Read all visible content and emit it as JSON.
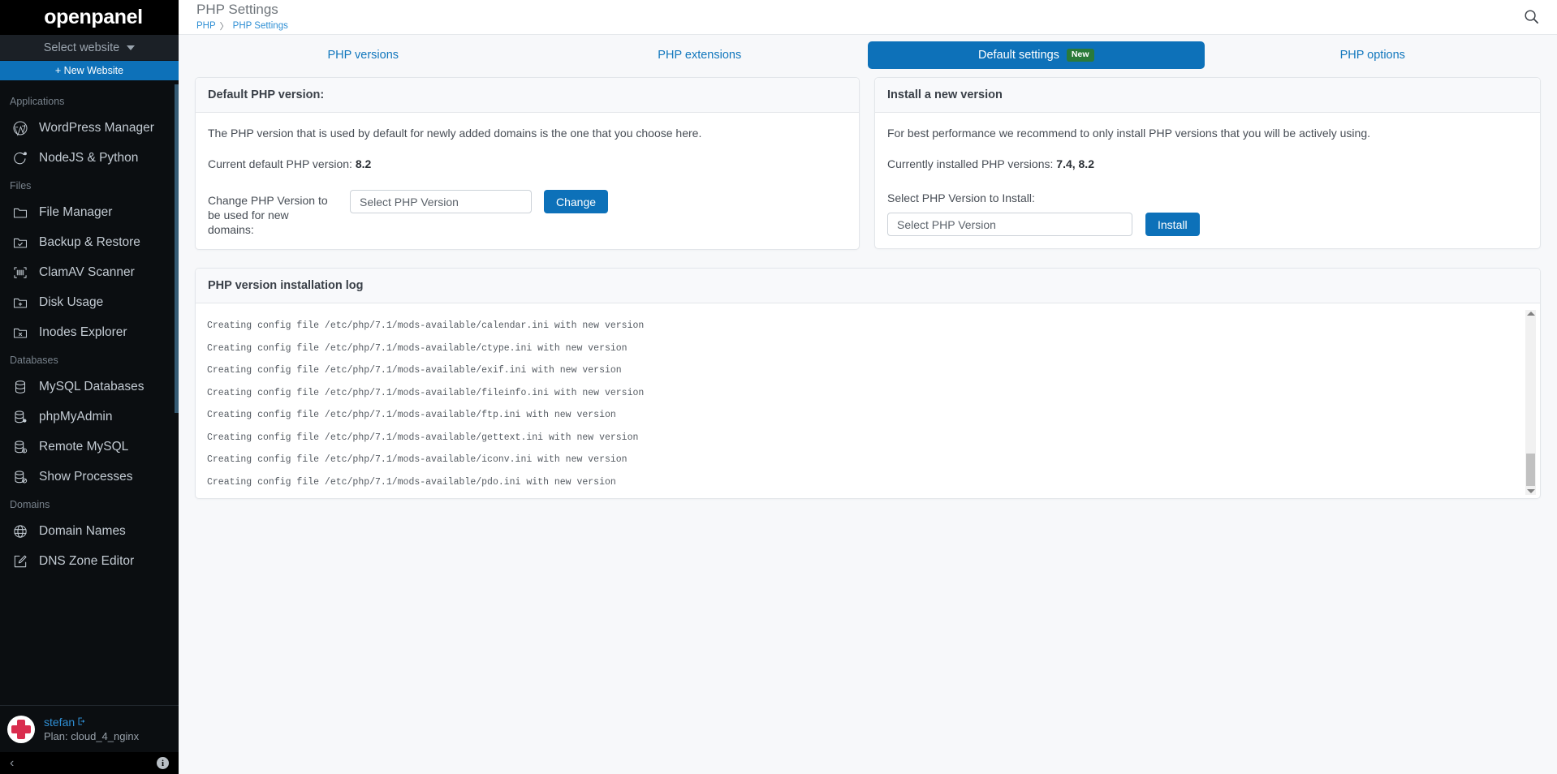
{
  "sidebar": {
    "brand": "openpanel",
    "site_select": "Select website",
    "new_website": "+ New Website",
    "groups": [
      {
        "label": "Applications",
        "items": [
          {
            "label": "WordPress Manager",
            "icon": "wordpress-icon"
          },
          {
            "label": "NodeJS & Python",
            "icon": "nodejs-icon"
          }
        ]
      },
      {
        "label": "Files",
        "items": [
          {
            "label": "File Manager",
            "icon": "folder-icon"
          },
          {
            "label": "Backup & Restore",
            "icon": "folder-check-icon"
          },
          {
            "label": "ClamAV Scanner",
            "icon": "scanner-icon"
          },
          {
            "label": "Disk Usage",
            "icon": "folder-plus-icon"
          },
          {
            "label": "Inodes Explorer",
            "icon": "folder-x-icon"
          }
        ]
      },
      {
        "label": "Databases",
        "items": [
          {
            "label": "MySQL Databases",
            "icon": "database-icon"
          },
          {
            "label": "phpMyAdmin",
            "icon": "database-gear-icon"
          },
          {
            "label": "Remote MySQL",
            "icon": "database-info-icon"
          },
          {
            "label": "Show Processes",
            "icon": "database-block-icon"
          }
        ]
      },
      {
        "label": "Domains",
        "items": [
          {
            "label": "Domain Names",
            "icon": "globe-icon"
          },
          {
            "label": "DNS Zone Editor",
            "icon": "edit-square-icon"
          }
        ]
      }
    ],
    "user": {
      "name": "stefan",
      "plan": "Plan: cloud_4_nginx"
    },
    "footer": {
      "collapse": "‹",
      "info": "i"
    }
  },
  "header": {
    "title": "PHP Settings",
    "breadcrumb": {
      "root": "PHP",
      "separator": "〉",
      "current": "PHP Settings"
    },
    "search_icon": "search-icon"
  },
  "tabs": [
    {
      "label": "PHP versions",
      "active": false,
      "badge": ""
    },
    {
      "label": "PHP extensions",
      "active": false,
      "badge": ""
    },
    {
      "label": "Default settings",
      "active": true,
      "badge": "New"
    },
    {
      "label": "PHP options",
      "active": false,
      "badge": ""
    }
  ],
  "default_php_card": {
    "title": "Default PHP version:",
    "description": "The PHP version that is used by default for newly added domains is the one that you choose here.",
    "current_label": "Current default PHP version:",
    "current_value": "8.2",
    "change_label": "Change PHP Version to be used for new domains:",
    "select_placeholder": "Select PHP Version",
    "change_button": "Change"
  },
  "install_card": {
    "title": "Install a new version",
    "description": "For best performance we recommend to only install PHP versions that you will be actively using.",
    "installed_label": "Currently installed PHP versions:",
    "installed_value": "7.4, 8.2",
    "select_label": "Select PHP Version to Install:",
    "select_placeholder": "Select PHP Version",
    "install_button": "Install"
  },
  "log_card": {
    "title": "PHP version installation log",
    "lines": [
      "Creating config file /etc/php/7.1/mods-available/calendar.ini with new version",
      "Creating config file /etc/php/7.1/mods-available/ctype.ini with new version",
      "Creating config file /etc/php/7.1/mods-available/exif.ini with new version",
      "Creating config file /etc/php/7.1/mods-available/fileinfo.ini with new version",
      "Creating config file /etc/php/7.1/mods-available/ftp.ini with new version",
      "Creating config file /etc/php/7.1/mods-available/gettext.ini with new version",
      "Creating config file /etc/php/7.1/mods-available/iconv.ini with new version",
      "Creating config file /etc/php/7.1/mods-available/pdo.ini with new version"
    ]
  },
  "colors": {
    "accent": "#0d71b9",
    "link": "#2f8fd4",
    "badge_green": "#2a7a39",
    "sidebar_bg": "#0b0e11",
    "avatar_red": "#d92d4e"
  }
}
